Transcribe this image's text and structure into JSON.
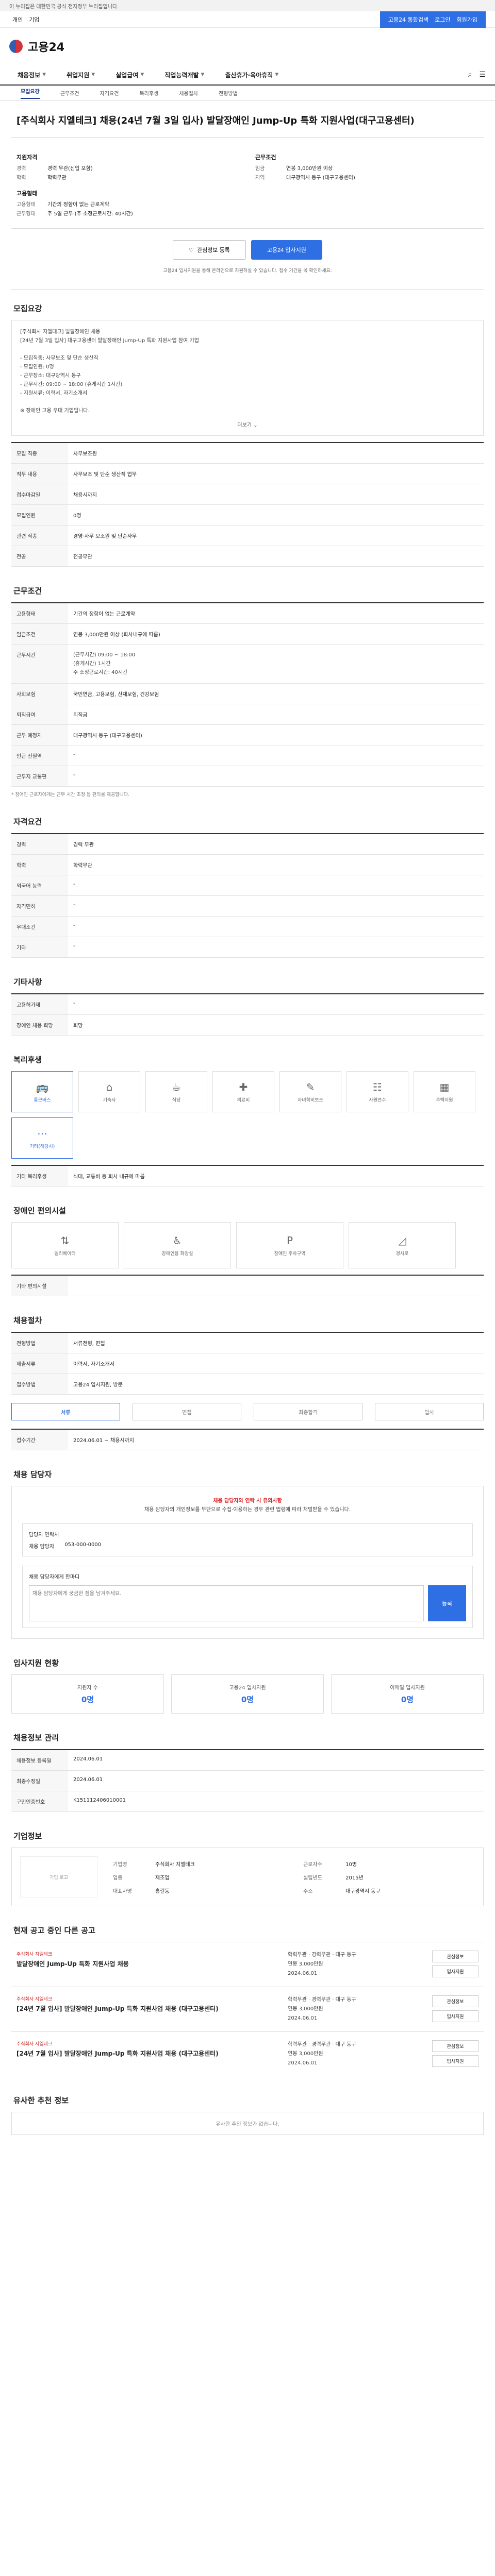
{
  "banner": {
    "text": "이 누리집은 대한민국 공식 전자정부 누리집입니다."
  },
  "topnav": {
    "left": [
      "개인",
      "기업"
    ],
    "right": [
      "고용24 통합검색",
      "로그인",
      "회원가입"
    ]
  },
  "header": {
    "logo": "고용24"
  },
  "gnb": [
    "채용정보",
    "취업지원",
    "실업급여",
    "직업능력개발",
    "출산휴가·육아휴직"
  ],
  "subtabs": [
    "모집요강",
    "근무조건",
    "자격요건",
    "복리후생",
    "채용절차",
    "전형방법"
  ],
  "title": "[주식회사 지엘테크] 채용(24년 7월 3일 입사) 발달장애인 Jump-Up 특화 지원사업(대구고용센터)",
  "summary": {
    "left_h1": "지원자격",
    "left": [
      {
        "k": "경력",
        "v": "경력 무관(신입 포함)"
      },
      {
        "k": "학력",
        "v": "학력무관"
      }
    ],
    "left_h2": "고용형태",
    "left2": [
      {
        "k": "고용형태",
        "v": "기간의 정함이 없는 근로계약"
      },
      {
        "k": "근무형태",
        "v": "주 5일 근무 (주 소정근로시간: 40시간)"
      }
    ],
    "right_h1": "근무조건",
    "right": [
      {
        "k": "임금",
        "v": "연봉 3,000만원 이상"
      },
      {
        "k": "지역",
        "v": "대구광역시 동구 (대구고용센터)"
      }
    ]
  },
  "actions": {
    "interest": "관심정보 등록",
    "apply": "고용24 입사지원"
  },
  "notice_line": "고용24 입사지원을 통해 온라인으로 지원하실 수 있습니다. 접수 기간을 꼭 확인하세요.",
  "sections": {
    "recruit": "모집요강",
    "recruit_text": "[주식회사 지엘테크] 발달장애인 채용\n[24년 7월 3일 입사] 대구고용센터 발달장애인 Jump-Up 특화 지원사업 참여 기업\n\n  - 모집직종: 사무보조 및 단순 생산직\n  - 모집인원: 0명\n  - 근무장소: 대구광역시 동구\n  - 근무시간: 09:00 ~ 18:00 (휴게시간 1시간)\n  - 지원서류: 이력서, 자기소개서\n\n※ 장애인 고용 우대 기업입니다.",
    "more": "더보기",
    "recruit_rows": [
      {
        "k": "모집 직종",
        "v": "사무보조원"
      },
      {
        "k": "직무 내용",
        "v": "사무보조 및 단순 생산직 업무"
      },
      {
        "k": "접수마감일",
        "v": "채용시까지"
      },
      {
        "k": "모집인원",
        "v": "0명"
      },
      {
        "k": "관련 직종",
        "v": "경영·사무 보조원 및 단순사무"
      },
      {
        "k": "전공",
        "v": "전공무관"
      }
    ],
    "work": "근무조건",
    "work_rows": [
      {
        "k": "고용형태",
        "v": "기간의 정함이 없는 근로계약"
      },
      {
        "k": "임금조건",
        "v": "연봉 3,000만원 이상 (회사내규에 따름)"
      },
      {
        "k": "근무시간",
        "v": "(근무시간) 09:00 ~ 18:00\n(휴게시간) 1시간\n주 소정근로시간: 40시간"
      },
      {
        "k": "사회보험",
        "v": "국민연금, 고용보험, 산재보험, 건강보험"
      },
      {
        "k": "퇴직급여",
        "v": "퇴직금"
      },
      {
        "k": "근무 예정지",
        "v": "대구광역시 동구 (대구고용센터)"
      },
      {
        "k": "인근 전철역",
        "v": "-"
      },
      {
        "k": "근무지 교통편",
        "v": "-"
      }
    ],
    "work_note": "* 장애인 근로자에게는 근무 시간 조정 등 편의를 제공합니다.",
    "qual": "자격요건",
    "qual_rows": [
      {
        "k": "경력",
        "v": "경력 무관"
      },
      {
        "k": "학력",
        "v": "학력무관"
      },
      {
        "k": "외국어 능력",
        "v": "-"
      },
      {
        "k": "자격면허",
        "v": "-"
      },
      {
        "k": "우대조건",
        "v": "-"
      },
      {
        "k": "기타",
        "v": "-"
      }
    ],
    "etc": "기타사항",
    "etc_rows": [
      {
        "k": "고용허가제",
        "v": "-"
      },
      {
        "k": "장애인 채용 희망",
        "v": "희망"
      }
    ],
    "welfare": "복리후생",
    "welfare_items": [
      "통근버스",
      "기숙사",
      "식당",
      "의료비",
      "자녀학비보조",
      "사원연수",
      "주택지원",
      "기타(해당시)"
    ],
    "welfare_note_label": "기타 복리후생",
    "welfare_note": "식대, 교통비 등 회사 내규에 따름",
    "disability": "장애인 편의시설",
    "disability_items": [
      "엘리베이터",
      "장애인용 화장실",
      "장애인 주차구역",
      "경사로"
    ],
    "disability_note_label": "기타 편의시설",
    "process": "채용절차",
    "process_rows": [
      {
        "k": "전형방법",
        "v": "서류전형, 면접"
      },
      {
        "k": "제출서류",
        "v": "이력서, 자기소개서"
      },
      {
        "k": "접수방법",
        "v": "고용24 입사지원, 방문"
      }
    ],
    "steps": [
      "서류",
      "면접",
      "최종합격",
      "입사"
    ],
    "apply_period_label": "접수기간",
    "apply_period": "2024.06.01 ~ 채용시까지",
    "consult": "채용 담당자",
    "consult_warn1": "채용 담당자와 연락 시 유의사항",
    "consult_warn2": "채용 담당자의 개인정보를 무단으로 수집·이용하는 경우 관련 법령에 따라 처벌받을 수 있습니다.",
    "consult_sub": "담당자 연락처",
    "consult_person": "채용 담당자",
    "consult_phone": "053-000-0000",
    "comment_label": "채용 담당자에게 한마디",
    "comment_placeholder": "채용 담당자에게 궁금한 점을 남겨주세요.",
    "comment_btn": "등록",
    "stats_title": "입사지원 현황",
    "stats": [
      {
        "label": "지원자 수",
        "num": "0명"
      },
      {
        "label": "고용24 입사지원",
        "num": "0명"
      },
      {
        "label": "이메일 입사지원",
        "num": "0명"
      }
    ],
    "info_title": "채용정보 관리",
    "info_rows": [
      {
        "k": "채용정보 등록일",
        "v": "2024.06.01"
      },
      {
        "k": "최종수정일",
        "v": "2024.06.01"
      },
      {
        "k": "구인인증번호",
        "v": "K151112406010001"
      }
    ],
    "org_title": "기업정보",
    "org": {
      "logo": "기업 로고",
      "rows": [
        {
          "k": "기업명",
          "v": "주식회사 지엘테크"
        },
        {
          "k": "업종",
          "v": "제조업"
        },
        {
          "k": "대표자명",
          "v": "홍길동"
        },
        {
          "k": "근로자수",
          "v": "10명"
        },
        {
          "k": "설립년도",
          "v": "2015년"
        },
        {
          "k": "주소",
          "v": "대구광역시 동구"
        }
      ]
    },
    "related_title": "현재 공고 중인 다른 공고",
    "related": [
      {
        "corp": "주식회사 지엘테크",
        "title": "발달장애인 Jump-Up 특화 지원사업 채용",
        "info": "학력무관 · 경력무관 · 대구 동구",
        "pay": "연봉 3,000만원",
        "date": "2024.06.01"
      },
      {
        "corp": "주식회사 지엘테크",
        "title": "[24년 7월 입사] 발달장애인 Jump-Up 특화 지원사업 채용 (대구고용센터)",
        "info": "학력무관 · 경력무관 · 대구 동구",
        "pay": "연봉 3,000만원",
        "date": "2024.06.01"
      },
      {
        "corp": "주식회사 지엘테크",
        "title": "[24년 7월 입사] 발달장애인 Jump-Up 특화 지원사업 채용 (대구고용센터)",
        "info": "학력무관 · 경력무관 · 대구 동구",
        "pay": "연봉 3,000만원",
        "date": "2024.06.01"
      }
    ],
    "related_btns": [
      "관심정보",
      "입사지원"
    ],
    "similar_title": "유사한 추천 정보",
    "similar_note": "유사한 추천 정보가 없습니다."
  }
}
